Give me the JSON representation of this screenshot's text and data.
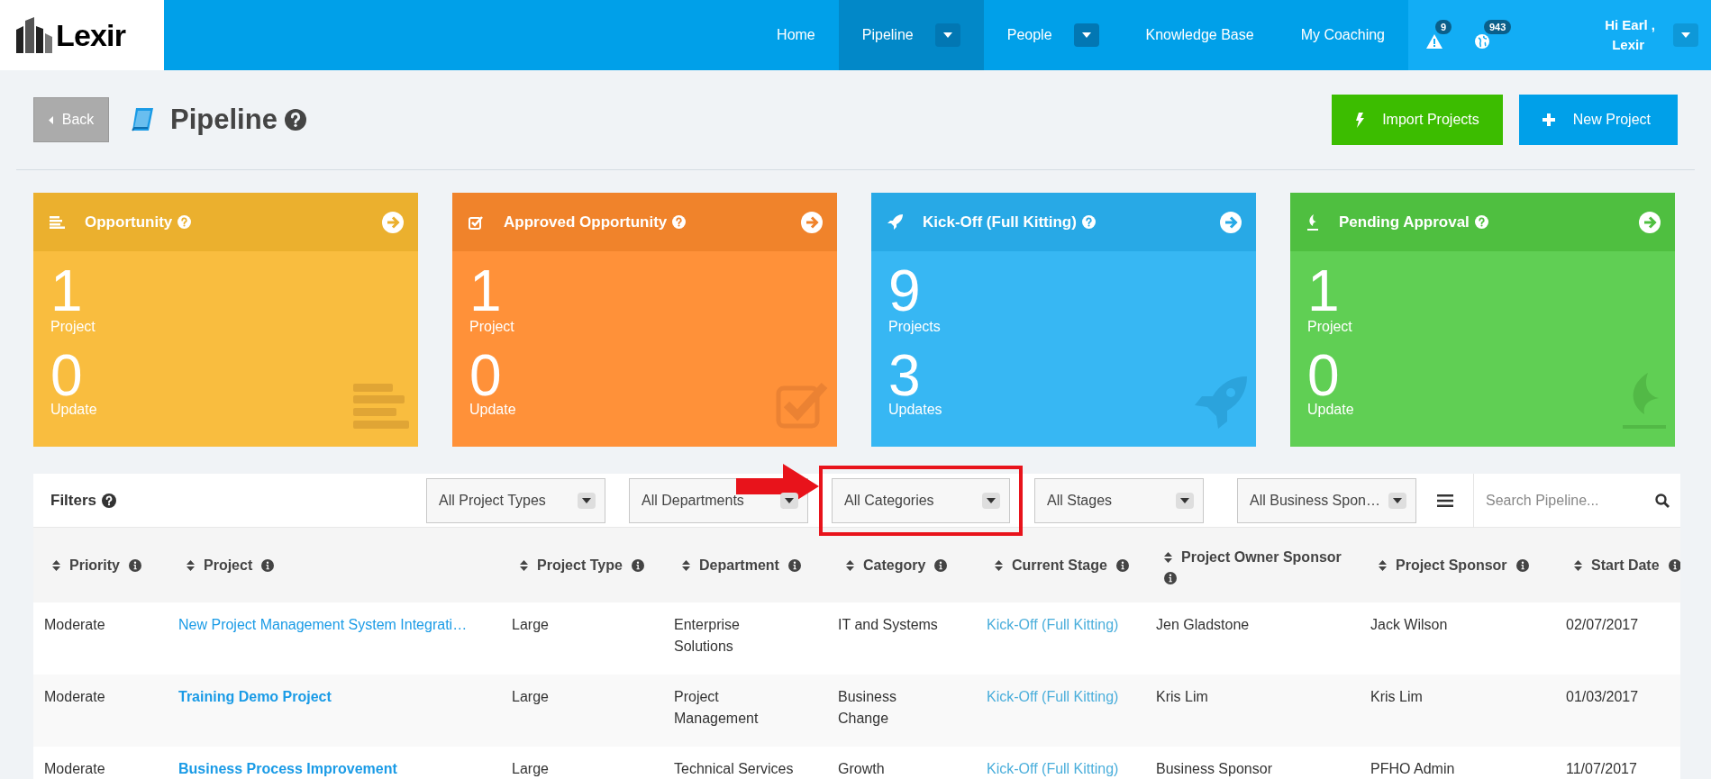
{
  "nav": {
    "logo": "Lexir",
    "items": [
      {
        "label": "Home",
        "selected": false,
        "dropdown": false
      },
      {
        "label": "Pipeline",
        "selected": true,
        "dropdown": true
      },
      {
        "label": "People",
        "selected": false,
        "dropdown": true
      },
      {
        "label": "Knowledge Base",
        "selected": false,
        "dropdown": false
      },
      {
        "label": "My Coaching",
        "selected": false,
        "dropdown": false
      }
    ],
    "notifications": [
      {
        "kind": "alert",
        "count": "9"
      },
      {
        "kind": "globe",
        "count": "943"
      }
    ],
    "user": {
      "greeting": "Hi Earl ,",
      "org": "Lexir"
    }
  },
  "header": {
    "back": "Back",
    "title": "Pipeline",
    "buttons": [
      {
        "kind": "import",
        "label": "Import Projects"
      },
      {
        "kind": "new",
        "label": "New Project"
      }
    ]
  },
  "cards": [
    {
      "kind": "opportunity",
      "color": "#f9bd3f",
      "title": "Opportunity",
      "count": "1",
      "count_label": "Project",
      "updates": "0",
      "updates_label": "Update"
    },
    {
      "kind": "approved",
      "color": "#ff9139",
      "title": "Approved Opportunity",
      "count": "1",
      "count_label": "Project",
      "updates": "0",
      "updates_label": "Update"
    },
    {
      "kind": "kickoff",
      "color": "#37b7f3",
      "title": "Kick-Off (Full Kitting)",
      "count": "9",
      "count_label": "Projects",
      "updates": "3",
      "updates_label": "Updates"
    },
    {
      "kind": "pending",
      "color": "#60cf54",
      "title": "Pending Approval",
      "count": "1",
      "count_label": "Project",
      "updates": "0",
      "updates_label": "Update"
    }
  ],
  "filters": {
    "label": "Filters",
    "dropdowns": [
      {
        "value": "All Project Types",
        "highlighted": false
      },
      {
        "value": "All Departments",
        "highlighted": false
      },
      {
        "value": "All Categories",
        "highlighted": true
      },
      {
        "value": "All Stages",
        "highlighted": false
      },
      {
        "value": "All Business Spon…",
        "highlighted": false
      }
    ],
    "search": {
      "placeholder": "Search Pipeline..."
    }
  },
  "table": {
    "columns": [
      {
        "label": "Priority",
        "kind": "text"
      },
      {
        "label": "Project",
        "kind": "project"
      },
      {
        "label": "Project Type",
        "kind": "text"
      },
      {
        "label": "Department",
        "kind": "text"
      },
      {
        "label": "Category",
        "kind": "text"
      },
      {
        "label": "Current Stage",
        "kind": "stage"
      },
      {
        "label": "Project Owner Sponsor",
        "kind": "text"
      },
      {
        "label": "Project Sponsor",
        "kind": "text"
      },
      {
        "label": "Start Date",
        "kind": "text"
      }
    ],
    "rows": [
      {
        "bold": false,
        "cells": [
          "Moderate",
          "New Project Management System Integrati…",
          "Large",
          "Enterprise Solutions",
          "IT and Systems",
          "Kick-Off (Full Kitting)",
          "Jen Gladstone",
          "Jack Wilson",
          "02/07/2017"
        ]
      },
      {
        "bold": true,
        "cells": [
          "Moderate",
          "Training Demo Project",
          "Large",
          "Project Management",
          "Business Change",
          "Kick-Off (Full Kitting)",
          "Kris Lim",
          "Kris Lim",
          "01/03/2017"
        ]
      },
      {
        "bold": true,
        "cells": [
          "Moderate",
          "Business Process Improvement",
          "Large",
          "Technical Services",
          "Growth",
          "Kick-Off (Full Kitting)",
          "Business Sponsor",
          "PFHO Admin",
          "11/07/2017"
        ]
      }
    ]
  }
}
